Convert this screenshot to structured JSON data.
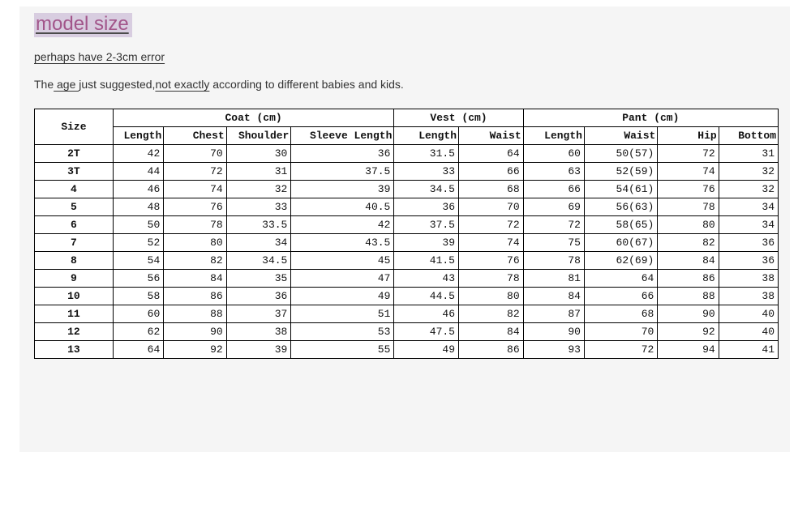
{
  "title": "model size",
  "note1": "perhaps have 2-3cm error",
  "note2_pre": "The",
  "note2_u1": " age ",
  "note2_mid": "just suggested,",
  "note2_u2": "not exactly",
  "note2_post": " according to different babies and kids.",
  "headers": {
    "size": "Size",
    "coat": "Coat (cm)",
    "vest": "Vest (cm)",
    "pant": "Pant (cm)",
    "coat_sub": [
      "Length",
      "Chest",
      "Shoulder",
      "Sleeve Length"
    ],
    "vest_sub": [
      "Length",
      "Waist"
    ],
    "pant_sub": [
      "Length",
      "Waist",
      "Hip",
      "Bottom"
    ]
  },
  "rows": [
    {
      "size": "2T",
      "coat": [
        "42",
        "70",
        "30",
        "36"
      ],
      "vest": [
        "31.5",
        "64"
      ],
      "pant": [
        "60",
        "50(57)",
        "72",
        "31"
      ]
    },
    {
      "size": "3T",
      "coat": [
        "44",
        "72",
        "31",
        "37.5"
      ],
      "vest": [
        "33",
        "66"
      ],
      "pant": [
        "63",
        "52(59)",
        "74",
        "32"
      ]
    },
    {
      "size": "4",
      "coat": [
        "46",
        "74",
        "32",
        "39"
      ],
      "vest": [
        "34.5",
        "68"
      ],
      "pant": [
        "66",
        "54(61)",
        "76",
        "32"
      ]
    },
    {
      "size": "5",
      "coat": [
        "48",
        "76",
        "33",
        "40.5"
      ],
      "vest": [
        "36",
        "70"
      ],
      "pant": [
        "69",
        "56(63)",
        "78",
        "34"
      ]
    },
    {
      "size": "6",
      "coat": [
        "50",
        "78",
        "33.5",
        "42"
      ],
      "vest": [
        "37.5",
        "72"
      ],
      "pant": [
        "72",
        "58(65)",
        "80",
        "34"
      ]
    },
    {
      "size": "7",
      "coat": [
        "52",
        "80",
        "34",
        "43.5"
      ],
      "vest": [
        "39",
        "74"
      ],
      "pant": [
        "75",
        "60(67)",
        "82",
        "36"
      ]
    },
    {
      "size": "8",
      "coat": [
        "54",
        "82",
        "34.5",
        "45"
      ],
      "vest": [
        "41.5",
        "76"
      ],
      "pant": [
        "78",
        "62(69)",
        "84",
        "36"
      ]
    },
    {
      "size": "9",
      "coat": [
        "56",
        "84",
        "35",
        "47"
      ],
      "vest": [
        "43",
        "78"
      ],
      "pant": [
        "81",
        "64",
        "86",
        "38"
      ]
    },
    {
      "size": "10",
      "coat": [
        "58",
        "86",
        "36",
        "49"
      ],
      "vest": [
        "44.5",
        "80"
      ],
      "pant": [
        "84",
        "66",
        "88",
        "38"
      ]
    },
    {
      "size": "11",
      "coat": [
        "60",
        "88",
        "37",
        "51"
      ],
      "vest": [
        "46",
        "82"
      ],
      "pant": [
        "87",
        "68",
        "90",
        "40"
      ]
    },
    {
      "size": "12",
      "coat": [
        "62",
        "90",
        "38",
        "53"
      ],
      "vest": [
        "47.5",
        "84"
      ],
      "pant": [
        "90",
        "70",
        "92",
        "40"
      ]
    },
    {
      "size": "13",
      "coat": [
        "64",
        "92",
        "39",
        "55"
      ],
      "vest": [
        "49",
        "86"
      ],
      "pant": [
        "93",
        "72",
        "94",
        "41"
      ]
    }
  ]
}
